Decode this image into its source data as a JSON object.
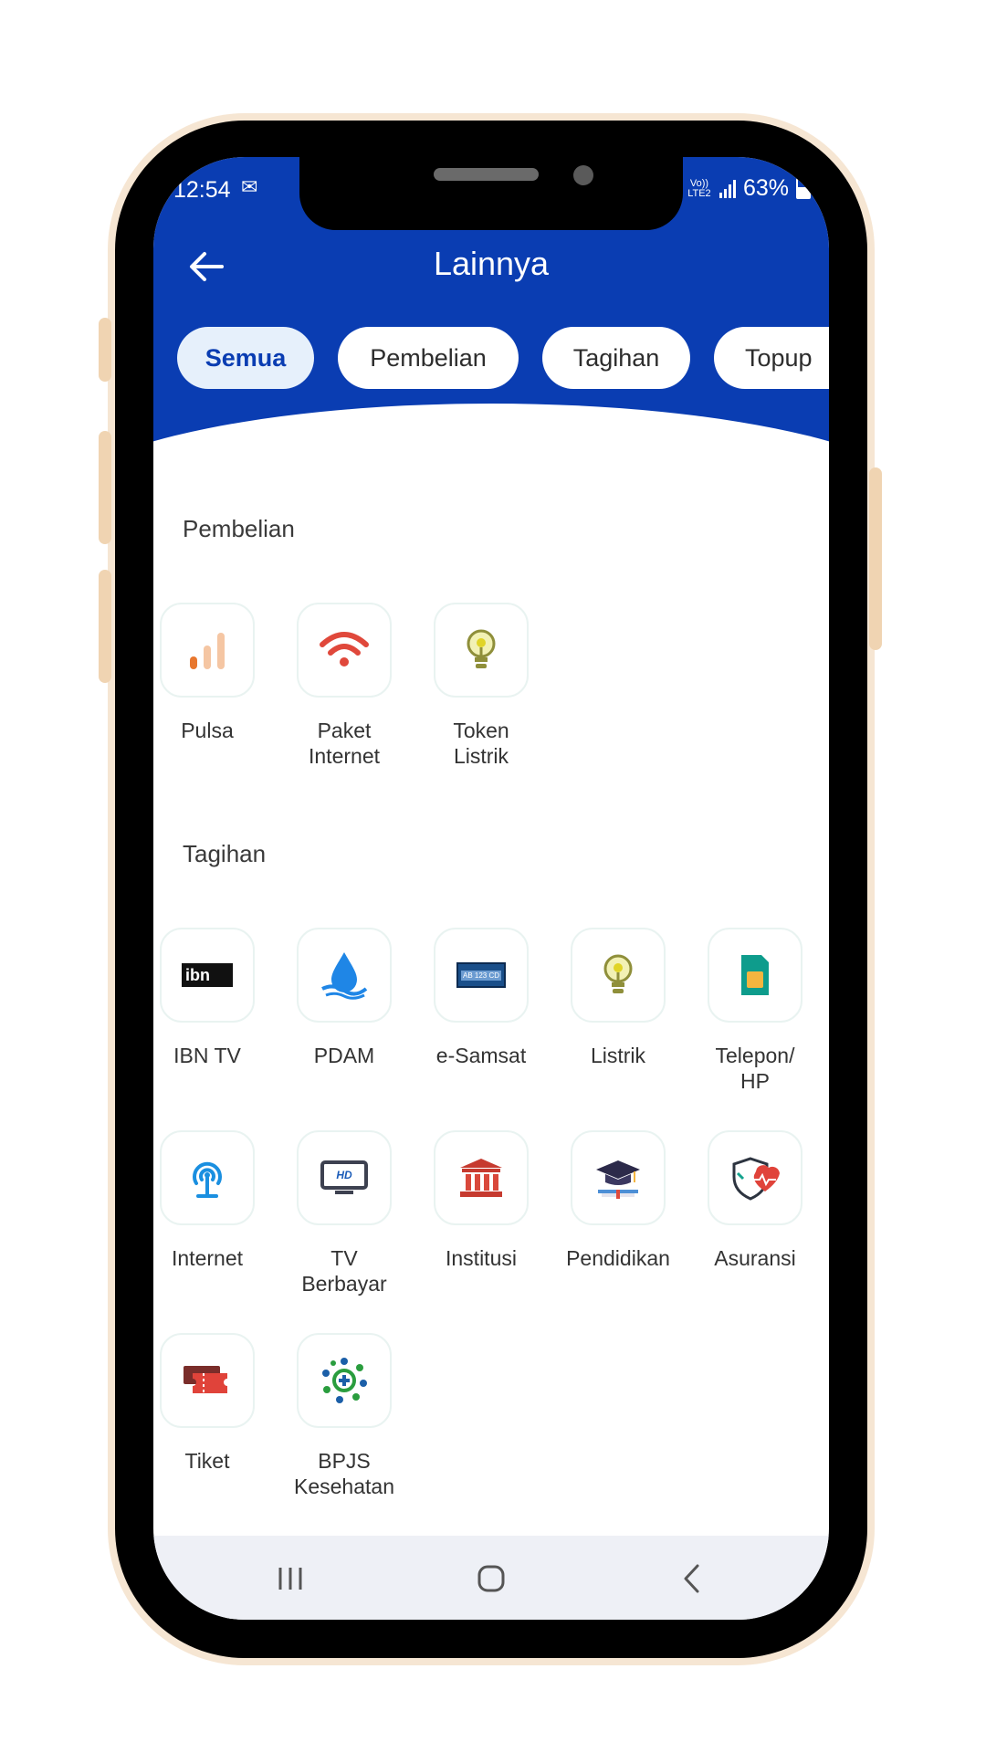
{
  "status_bar": {
    "time": "12:54",
    "network": "Vo)) LTE2",
    "battery": "63%"
  },
  "header": {
    "title": "Lainnya"
  },
  "tabs": [
    {
      "label": "Semua",
      "active": true
    },
    {
      "label": "Pembelian",
      "active": false
    },
    {
      "label": "Tagihan",
      "active": false
    },
    {
      "label": "Topup",
      "active": false
    }
  ],
  "sections": {
    "pembelian": {
      "title": "Pembelian",
      "items": [
        {
          "label": "Pulsa",
          "icon": "signal-bars-icon"
        },
        {
          "label": "Paket\nInternet",
          "icon": "wifi-icon"
        },
        {
          "label": "Token\nListrik",
          "icon": "lightbulb-icon"
        }
      ]
    },
    "tagihan": {
      "title": "Tagihan",
      "items": [
        {
          "label": "IBN TV",
          "icon": "ibn-logo-icon"
        },
        {
          "label": "PDAM",
          "icon": "water-drop-icon"
        },
        {
          "label": "e-Samsat",
          "icon": "license-plate-icon"
        },
        {
          "label": "Listrik",
          "icon": "lightbulb-icon"
        },
        {
          "label": "Telepon/\nHP",
          "icon": "sim-card-icon"
        },
        {
          "label": "Internet",
          "icon": "broadcast-icon"
        },
        {
          "label": "TV\nBerbayar",
          "icon": "hd-tv-icon"
        },
        {
          "label": "Institusi",
          "icon": "institution-icon"
        },
        {
          "label": "Pendidikan",
          "icon": "graduation-cap-icon"
        },
        {
          "label": "Asuransi",
          "icon": "insurance-shield-icon"
        },
        {
          "label": "Tiket",
          "icon": "ticket-icon"
        },
        {
          "label": "BPJS\nKesehatan",
          "icon": "bpjs-logo-icon"
        }
      ]
    }
  },
  "ibn_logo_text": "ibn",
  "plate_text": "AB 123 CD",
  "hd_text": "HD",
  "colors": {
    "primary": "#0a3db2",
    "tab_active_bg": "#e6f0fb",
    "frame": "#f6e6d3"
  }
}
